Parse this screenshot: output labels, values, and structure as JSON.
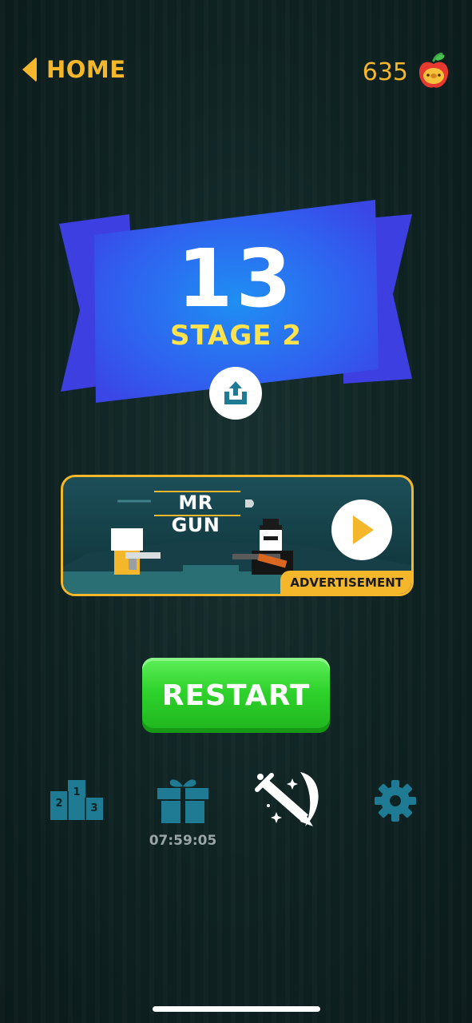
{
  "top_bar": {
    "home_label": "HOME",
    "coin_count": "635"
  },
  "result": {
    "level_number": "13",
    "stage_label": "STAGE 2"
  },
  "ad": {
    "title": "MR GUN",
    "label": "ADVERTISEMENT"
  },
  "restart_label": "RESTART",
  "bottom_bar": {
    "gift_timer": "07:59:05",
    "podium_numbers": [
      "2",
      "1",
      "3"
    ]
  },
  "colors": {
    "accent_yellow": "#f4b62b",
    "ribbon_blue": "#3a56f2",
    "button_green": "#2ed22b",
    "icon_teal": "#1f7a94"
  }
}
